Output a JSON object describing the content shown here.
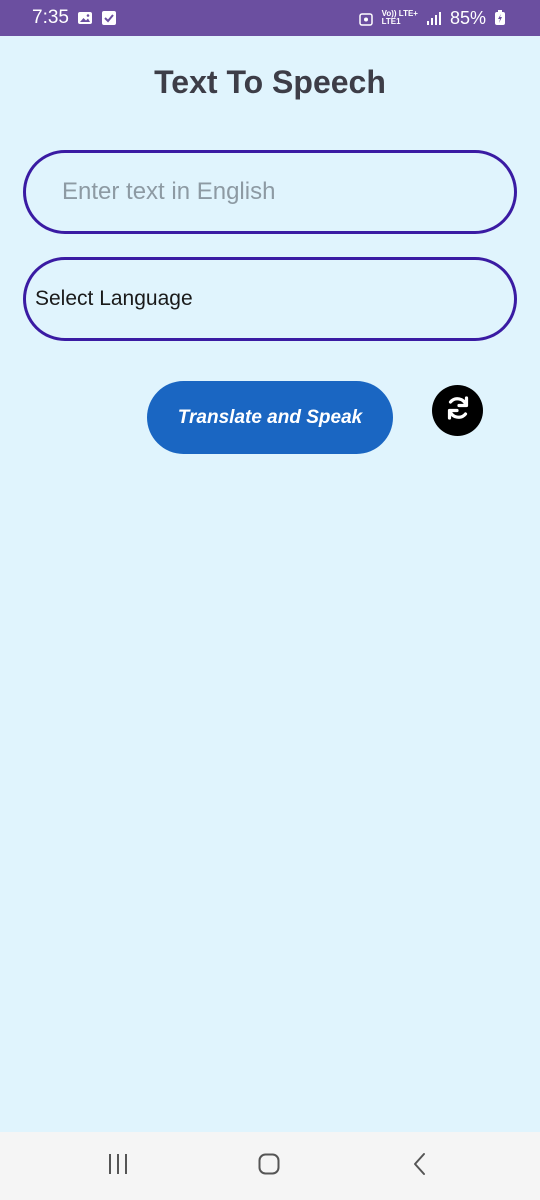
{
  "status_bar": {
    "time": "7:35",
    "network_top": "Vo)) LTE+",
    "network_bottom": "LTE1",
    "battery": "85%"
  },
  "title": "Text To Speech",
  "text_input": {
    "placeholder": "Enter text in English",
    "value": ""
  },
  "language_select": {
    "selected": "Select Language"
  },
  "translate_button": {
    "label": "Translate and Speak"
  },
  "colors": {
    "background": "#e0f4fd",
    "status_bar": "#6b4fa0",
    "field_border": "#3a1ba3",
    "button": "#1a66c2"
  },
  "icons": {
    "refresh": "refresh-icon",
    "nav_recents": "recents-icon",
    "nav_home": "home-icon",
    "nav_back": "back-icon"
  }
}
